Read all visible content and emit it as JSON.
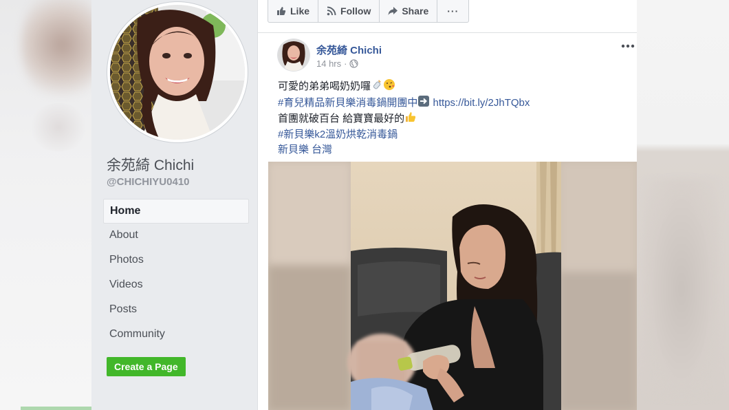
{
  "page": {
    "name": "余苑綺 Chichi",
    "handle": "@CHICHIYU0410"
  },
  "nav": {
    "items": [
      {
        "label": "Home"
      },
      {
        "label": "About"
      },
      {
        "label": "Photos"
      },
      {
        "label": "Videos"
      },
      {
        "label": "Posts"
      },
      {
        "label": "Community"
      }
    ],
    "active_index": 0,
    "create_page_label": "Create a Page"
  },
  "actions": {
    "like": "Like",
    "follow": "Follow",
    "share": "Share",
    "more": "···"
  },
  "post": {
    "author": "余苑綺 Chichi",
    "time": "14 hrs",
    "line1": "可愛的弟弟喝奶奶囉",
    "line2_hashtag": "#育兒精品新貝樂消毒鍋開團中",
    "line2_link": "https://bit.ly/2JhTQbx",
    "line3": "首團就破百台 給寶寶最好的",
    "line4_hashtag": "#新貝樂k2溫奶烘乾消毒鍋",
    "line5": "新貝樂 台灣"
  },
  "colors": {
    "link": "#365899",
    "sidebar_bg": "#e9ebee",
    "create_button": "#42b72a"
  },
  "icons": {
    "like": "thumbs-up-icon",
    "follow": "rss-icon",
    "share": "share-arrow-icon",
    "privacy": "globe-icon",
    "more": "more-dots-icon"
  }
}
